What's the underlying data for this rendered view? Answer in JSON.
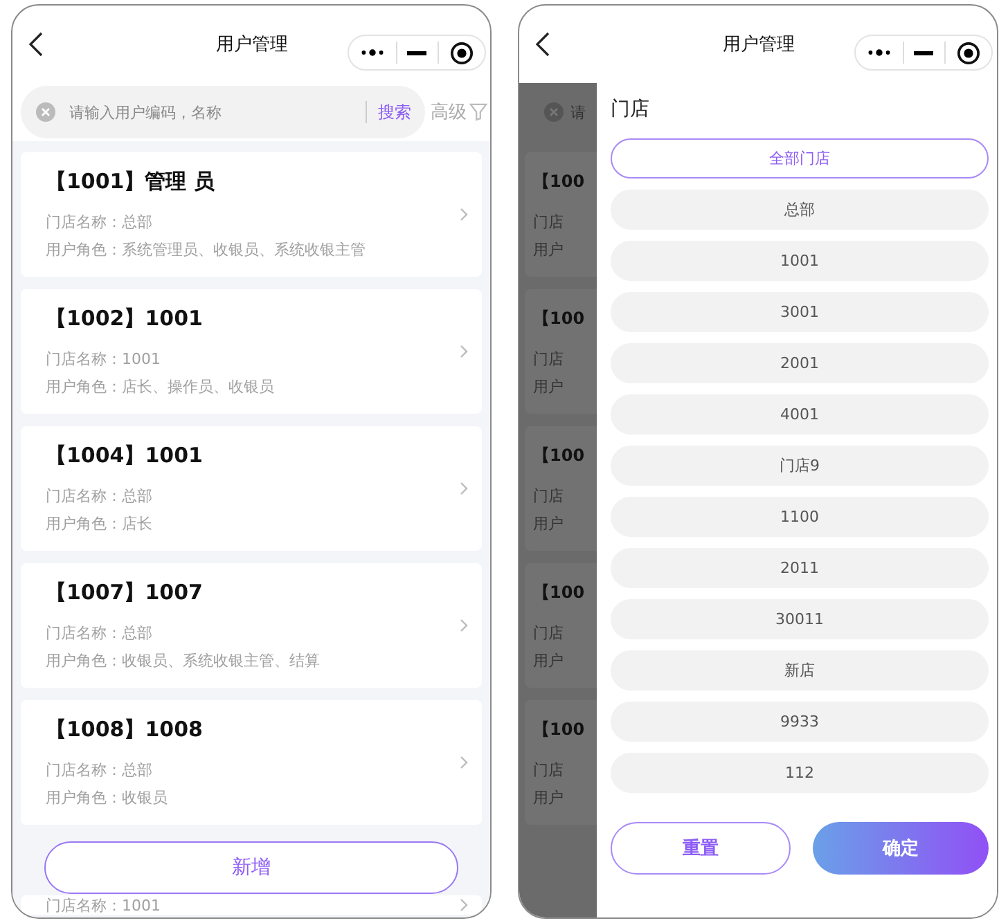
{
  "left": {
    "title": "用户管理",
    "search": {
      "placeholder": "请输入用户编码，名称",
      "button": "搜索",
      "advanced": "高级"
    },
    "users": [
      {
        "title": "【1001】管理 员",
        "store_label": "门店名称：",
        "store": "总部",
        "role_label": "用户角色：",
        "roles": "系统管理员、收银员、系统收银主管"
      },
      {
        "title": "【1002】1001",
        "store_label": "门店名称：",
        "store": "1001",
        "role_label": "用户角色：",
        "roles": "店长、操作员、收银员"
      },
      {
        "title": "【1004】1001",
        "store_label": "门店名称：",
        "store": "总部",
        "role_label": "用户角色：",
        "roles": "店长"
      },
      {
        "title": "【1007】1007",
        "store_label": "门店名称：",
        "store": "总部",
        "role_label": "用户角色：",
        "roles": "收银员、系统收银主管、结算"
      },
      {
        "title": "【1008】1008",
        "store_label": "门店名称：",
        "store": "总部",
        "role_label": "用户角色：",
        "roles": "收银员"
      },
      {
        "store_label": "门店名称：",
        "store": "1001"
      }
    ],
    "add_button": "新增"
  },
  "right": {
    "title": "用户管理",
    "backdrop": {
      "search": "请",
      "cards": [
        {
          "title": "【100",
          "store": "门店",
          "role": "用户"
        },
        {
          "title": "【100",
          "store": "门店",
          "role": "用户"
        },
        {
          "title": "【100",
          "store": "门店",
          "role": "用户"
        },
        {
          "title": "【100",
          "store": "门店",
          "role": "用户"
        },
        {
          "title": "【100",
          "store": "门店",
          "role": "用户"
        }
      ]
    },
    "drawer": {
      "heading": "门店",
      "stores": [
        {
          "label": "全部门店",
          "selected": true
        },
        {
          "label": "总部",
          "selected": false
        },
        {
          "label": "1001",
          "selected": false
        },
        {
          "label": "3001",
          "selected": false
        },
        {
          "label": "2001",
          "selected": false
        },
        {
          "label": "4001",
          "selected": false
        },
        {
          "label": "门店9",
          "selected": false
        },
        {
          "label": "1100",
          "selected": false
        },
        {
          "label": "2011",
          "selected": false
        },
        {
          "label": "30011",
          "selected": false
        },
        {
          "label": "新店",
          "selected": false
        },
        {
          "label": "9933",
          "selected": false
        },
        {
          "label": "112",
          "selected": false
        }
      ],
      "reset": "重置",
      "confirm": "确定"
    }
  }
}
